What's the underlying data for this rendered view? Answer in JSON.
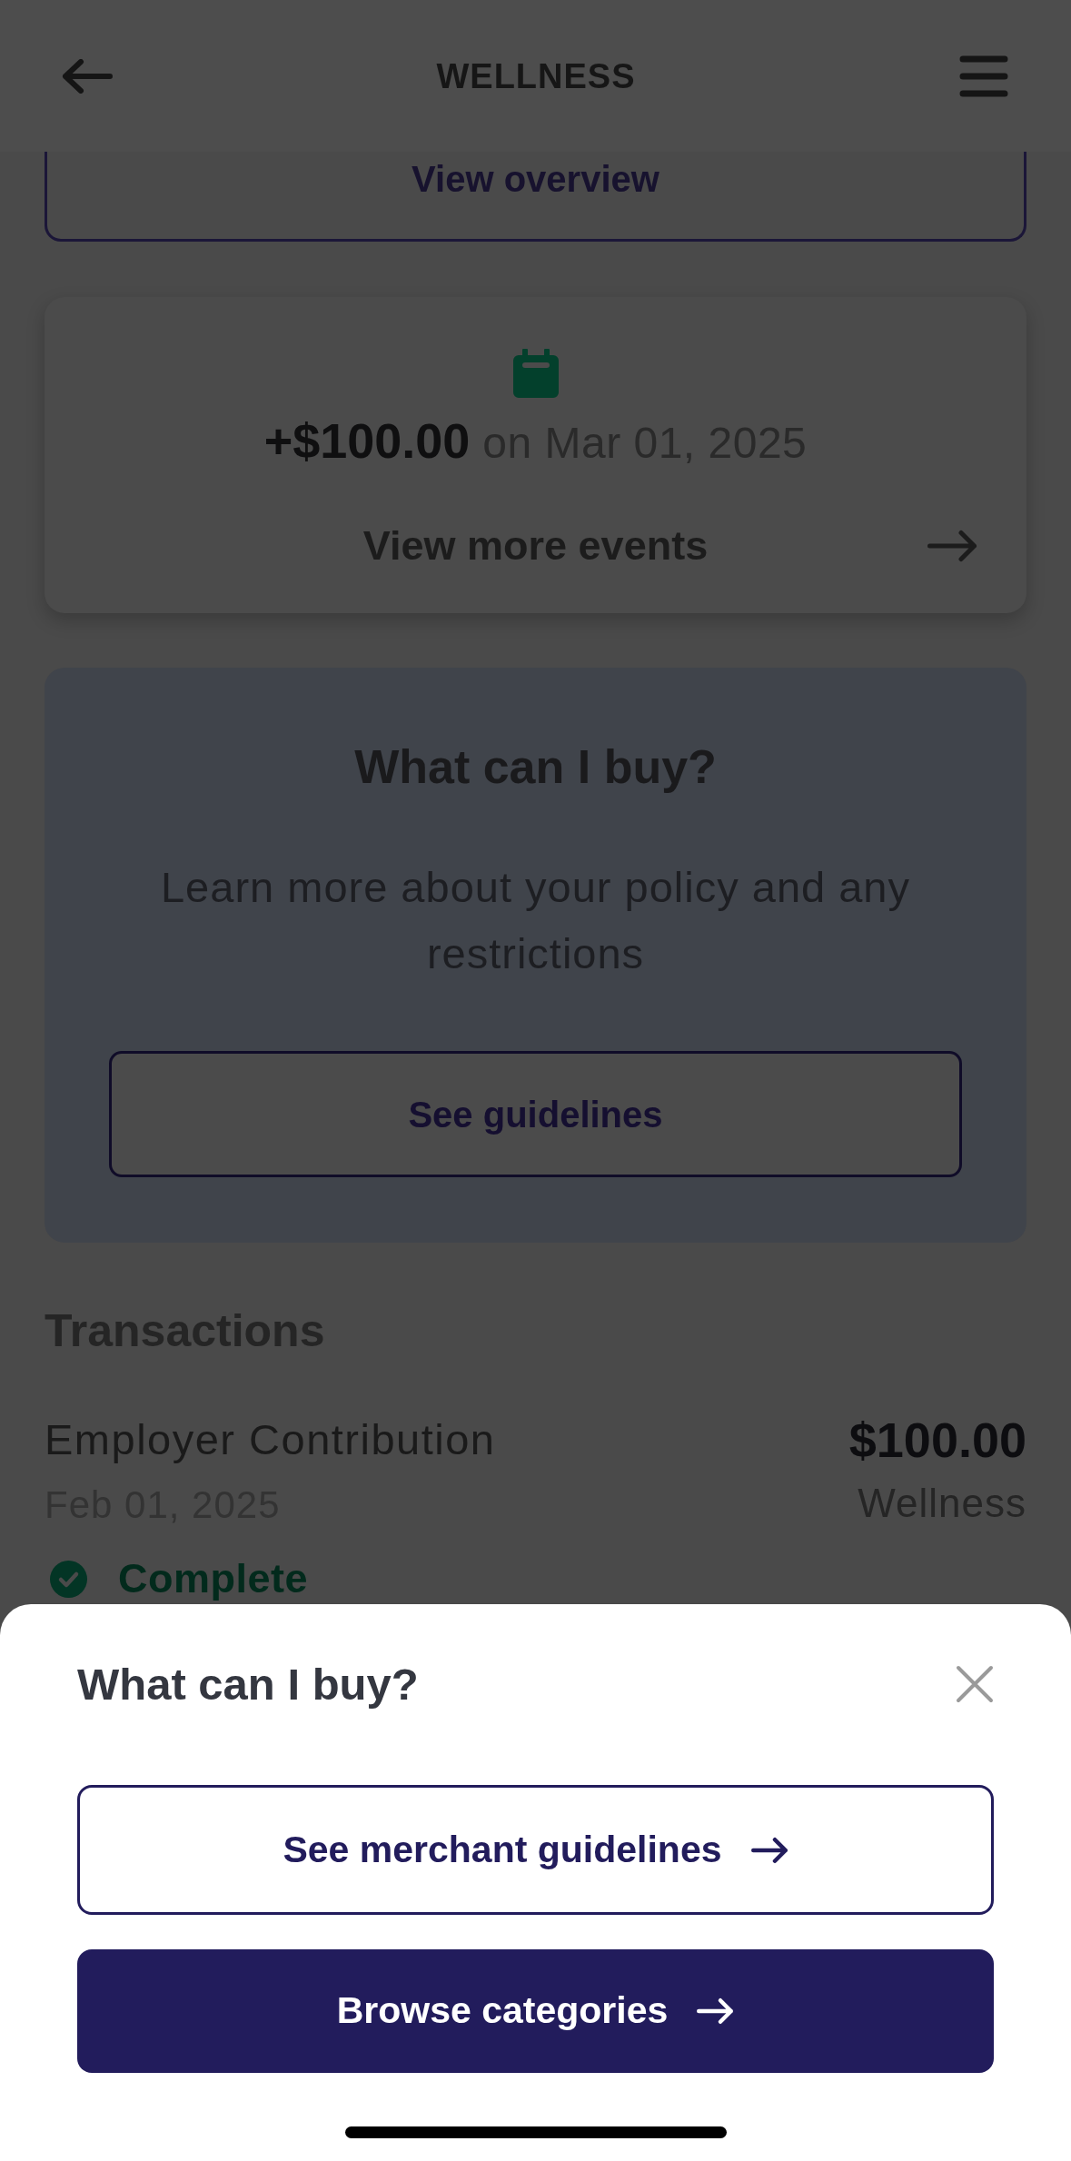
{
  "header": {
    "title": "WELLNESS"
  },
  "overview": {
    "button": "View overview"
  },
  "event_card": {
    "summary": "**+$100.00** on Mar 01, 2025",
    "link": "View more events"
  },
  "policy_card": {
    "title": "What can I buy?",
    "text": "Learn more about your policy and any restrictions",
    "button": "See guidelines"
  },
  "transactions": {
    "title": "Transactions",
    "items": [
      {
        "name": "Employer Contribution",
        "date": "Feb 01, 2025",
        "amount": "$100.00",
        "category": "Wellness",
        "status": {
          "kind": "complete",
          "label": "Complete"
        }
      }
    ]
  },
  "sheet": {
    "title": "What can I buy?",
    "buttons": [
      {
        "kind": "outline",
        "label": "See merchant guidelines"
      },
      {
        "kind": "primary",
        "label": "Browse categories"
      }
    ]
  }
}
